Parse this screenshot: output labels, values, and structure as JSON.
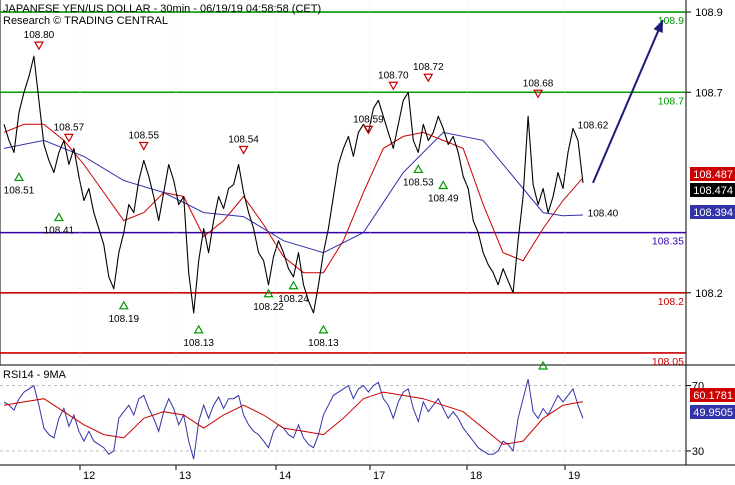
{
  "header": {
    "title": "JAPANESE YEN/US DOLLAR - 30min - 06/19/19 04:58:58 (CET)",
    "subtitle": "Research © TRADING CENTRAL"
  },
  "chart_data": [
    {
      "type": "line",
      "panel": "price",
      "x_tick_labels": [
        "12",
        "13",
        "14",
        "17",
        "18",
        "19"
      ],
      "y_tick_labels": [
        "108.9",
        "108.7",
        "108.2"
      ],
      "ylim": [
        108.02,
        108.93
      ],
      "series": [
        {
          "role": "price",
          "color": "#000000",
          "x": [
            0,
            5,
            10,
            15,
            20,
            25,
            30,
            35,
            40,
            45,
            50,
            55,
            60,
            65,
            70,
            75,
            80,
            85,
            90,
            95,
            100,
            105,
            110,
            115,
            120,
            125,
            130,
            135,
            140,
            145,
            150,
            155,
            160,
            165,
            170,
            175,
            180,
            185,
            190,
            195,
            200,
            205,
            210,
            215,
            220,
            225,
            230,
            235,
            240,
            245,
            250,
            255,
            260,
            265,
            270,
            275,
            280,
            285,
            290,
            295,
            300,
            305,
            310,
            315,
            320,
            325,
            330,
            335,
            340,
            345,
            350,
            355,
            360,
            365,
            370,
            375,
            380,
            385,
            390,
            395,
            400,
            405,
            410,
            415,
            420,
            425,
            430,
            435,
            440,
            445,
            450,
            455,
            460,
            465,
            470,
            475,
            480,
            485,
            490,
            495,
            500,
            505,
            510,
            515,
            520,
            525,
            530,
            535,
            540,
            545,
            550,
            555,
            560,
            565,
            570,
            575,
            580
          ],
          "y": [
            108.62,
            108.58,
            108.55,
            108.65,
            108.7,
            108.74,
            108.79,
            108.68,
            108.57,
            108.53,
            108.5,
            108.55,
            108.58,
            108.52,
            108.56,
            108.49,
            108.43,
            108.46,
            108.4,
            108.36,
            108.32,
            108.24,
            108.21,
            108.3,
            108.35,
            108.42,
            108.4,
            108.48,
            108.53,
            108.49,
            108.44,
            108.38,
            108.45,
            108.52,
            108.48,
            108.42,
            108.44,
            108.25,
            108.15,
            108.28,
            108.36,
            108.3,
            108.38,
            108.44,
            108.41,
            108.46,
            108.47,
            108.52,
            108.45,
            108.4,
            108.36,
            108.3,
            108.28,
            108.22,
            108.29,
            108.33,
            108.3,
            108.26,
            108.24,
            108.3,
            108.22,
            108.18,
            108.15,
            108.22,
            108.3,
            108.36,
            108.44,
            108.52,
            108.56,
            108.59,
            108.54,
            108.6,
            108.62,
            108.6,
            108.66,
            108.68,
            108.64,
            108.6,
            108.56,
            108.62,
            108.68,
            108.7,
            108.58,
            108.55,
            108.62,
            108.58,
            108.6,
            108.64,
            108.61,
            108.57,
            108.59,
            108.55,
            108.49,
            108.46,
            108.38,
            108.35,
            108.3,
            108.27,
            108.25,
            108.22,
            108.26,
            108.23,
            108.2,
            108.33,
            108.44,
            108.64,
            108.47,
            108.42,
            108.46,
            108.4,
            108.44,
            108.5,
            108.46,
            108.55,
            108.61,
            108.58,
            108.474
          ]
        },
        {
          "role": "fast-ma",
          "color": "#cc0000",
          "x": [
            0,
            20,
            40,
            60,
            80,
            100,
            120,
            140,
            160,
            180,
            200,
            220,
            240,
            260,
            280,
            300,
            320,
            340,
            360,
            380,
            400,
            420,
            440,
            460,
            480,
            500,
            520,
            540,
            560,
            580
          ],
          "y": [
            108.6,
            108.62,
            108.62,
            108.58,
            108.52,
            108.45,
            108.38,
            108.4,
            108.45,
            108.44,
            108.34,
            108.38,
            108.44,
            108.37,
            108.29,
            108.25,
            108.25,
            108.33,
            108.45,
            108.56,
            108.59,
            108.6,
            108.58,
            108.56,
            108.42,
            108.3,
            108.28,
            108.36,
            108.43,
            108.487
          ]
        },
        {
          "role": "slow-ma",
          "color": "#3333aa",
          "x": [
            0,
            40,
            80,
            120,
            160,
            200,
            240,
            280,
            320,
            360,
            400,
            440,
            480,
            520,
            540,
            560,
            580
          ],
          "y": [
            108.56,
            108.58,
            108.54,
            108.48,
            108.45,
            108.4,
            108.39,
            108.33,
            108.3,
            108.35,
            108.5,
            108.6,
            108.58,
            108.46,
            108.4,
            108.392,
            108.394
          ]
        }
      ],
      "levels": [
        {
          "value": 108.9,
          "label": "108.9",
          "color": "#009900"
        },
        {
          "value": 108.7,
          "label": "108.7",
          "color": "#009900"
        },
        {
          "value": 108.35,
          "label": "108.35",
          "color": "#3300aa"
        },
        {
          "value": 108.2,
          "label": "108.2",
          "color": "#cc0000"
        },
        {
          "value": 108.05,
          "label": "108.05",
          "color": "#cc0000"
        }
      ],
      "badges": [
        {
          "value": 108.487,
          "label": "108.487",
          "bg": "#cc0000",
          "fg": "#ffffff"
        },
        {
          "value": 108.474,
          "label": "108.474",
          "bg": "#000000",
          "fg": "#ffffff"
        },
        {
          "value": 108.394,
          "label": "108.394",
          "bg": "#3333aa",
          "fg": "#ffffff"
        }
      ],
      "highs": [
        {
          "x": 7,
          "value": 108.8,
          "label": "108.80"
        },
        {
          "x": 13,
          "value": 108.57,
          "label": "108.57"
        },
        {
          "x": 28,
          "value": 108.55,
          "label": "108.55"
        },
        {
          "x": 48,
          "value": 108.54,
          "label": "108.54"
        },
        {
          "x": 73,
          "value": 108.59,
          "label": "108.59"
        },
        {
          "x": 78,
          "value": 108.7,
          "label": "108.70"
        },
        {
          "x": 85,
          "value": 108.72,
          "label": "108.72"
        },
        {
          "x": 107,
          "value": 108.68,
          "label": "108.68"
        }
      ],
      "lows": [
        {
          "x": 3,
          "value": 108.51,
          "label": "108.51"
        },
        {
          "x": 11,
          "value": 108.41,
          "label": "108.41"
        },
        {
          "x": 24,
          "value": 108.19,
          "label": "108.19"
        },
        {
          "x": 39,
          "value": 108.13,
          "label": "108.13"
        },
        {
          "x": 53,
          "value": 108.22,
          "label": "108.22"
        },
        {
          "x": 58,
          "value": 108.24,
          "label": "108.24"
        },
        {
          "x": 64,
          "value": 108.13,
          "label": "108.13"
        },
        {
          "x": 83,
          "value": 108.53,
          "label": "108.53"
        },
        {
          "x": 88,
          "value": 108.49,
          "label": "108.49"
        },
        {
          "x": 108,
          "value": 108.04,
          "label": ""
        }
      ],
      "annotations": [
        {
          "x": 118,
          "value": 108.62,
          "label": "108.62"
        },
        {
          "x": 120,
          "value": 108.4,
          "label": "108.40"
        }
      ],
      "projection": {
        "x_from": 118,
        "y_from": 108.474,
        "x_to": 132,
        "y_to": 108.88,
        "color": "#1a1a7a"
      }
    },
    {
      "type": "line",
      "panel": "rsi",
      "title": "RSI14 - 9MA",
      "y_tick_labels": [
        "70",
        "30"
      ],
      "ylim": [
        22,
        82
      ],
      "series": [
        {
          "role": "rsi",
          "color": "#3333aa",
          "x": [
            0,
            5,
            10,
            15,
            20,
            25,
            30,
            35,
            40,
            45,
            50,
            55,
            60,
            65,
            70,
            75,
            80,
            85,
            90,
            95,
            100,
            105,
            110,
            115,
            120,
            125,
            130,
            135,
            140,
            145,
            150,
            155,
            160,
            165,
            170,
            175,
            180,
            185,
            190,
            195,
            200,
            205,
            210,
            215,
            220,
            225,
            230,
            235,
            240,
            245,
            250,
            255,
            260,
            265,
            270,
            275,
            280,
            285,
            290,
            295,
            300,
            305,
            310,
            315,
            320,
            325,
            330,
            335,
            340,
            345,
            350,
            355,
            360,
            365,
            370,
            375,
            380,
            385,
            390,
            395,
            400,
            405,
            410,
            415,
            420,
            425,
            430,
            435,
            440,
            445,
            450,
            455,
            460,
            465,
            470,
            475,
            480,
            485,
            490,
            495,
            500,
            505,
            510,
            515,
            520,
            525,
            530,
            535,
            540,
            545,
            550,
            555,
            560,
            565,
            570,
            575,
            580
          ],
          "y": [
            60,
            58,
            55,
            62,
            66,
            68,
            70,
            58,
            44,
            40,
            38,
            50,
            56,
            45,
            52,
            42,
            36,
            42,
            36,
            34,
            32,
            28,
            30,
            50,
            54,
            58,
            52,
            62,
            64,
            56,
            50,
            42,
            54,
            62,
            56,
            46,
            52,
            36,
            25,
            48,
            58,
            50,
            58,
            63,
            56,
            62,
            62,
            64,
            52,
            46,
            42,
            40,
            36,
            32,
            42,
            46,
            44,
            40,
            38,
            46,
            38,
            34,
            32,
            40,
            52,
            58,
            64,
            66,
            68,
            70,
            62,
            68,
            70,
            66,
            70,
            72,
            62,
            58,
            50,
            60,
            66,
            68,
            56,
            48,
            60,
            54,
            58,
            62,
            56,
            50,
            54,
            50,
            44,
            40,
            36,
            32,
            30,
            28,
            28,
            30,
            36,
            34,
            30,
            50,
            62,
            74,
            54,
            50,
            56,
            52,
            58,
            64,
            60,
            64,
            68,
            58,
            49.95
          ]
        },
        {
          "role": "rsi-ma",
          "color": "#cc0000",
          "x": [
            0,
            20,
            40,
            60,
            80,
            100,
            120,
            140,
            160,
            180,
            200,
            220,
            240,
            260,
            280,
            300,
            320,
            340,
            360,
            380,
            400,
            420,
            440,
            460,
            480,
            500,
            520,
            540,
            560,
            580
          ],
          "y": [
            58,
            60,
            62,
            54,
            46,
            40,
            38,
            50,
            54,
            52,
            44,
            52,
            58,
            52,
            44,
            42,
            40,
            50,
            62,
            66,
            64,
            62,
            58,
            54,
            44,
            34,
            36,
            50,
            58,
            60.18
          ]
        }
      ],
      "levels": [
        70,
        30
      ],
      "badges": [
        {
          "value": 60.1781,
          "label": "60.1781",
          "bg": "#cc0000",
          "fg": "#ffffff"
        },
        {
          "value": 49.9505,
          "label": "49.9505",
          "bg": "#3333aa",
          "fg": "#ffffff"
        }
      ]
    }
  ]
}
